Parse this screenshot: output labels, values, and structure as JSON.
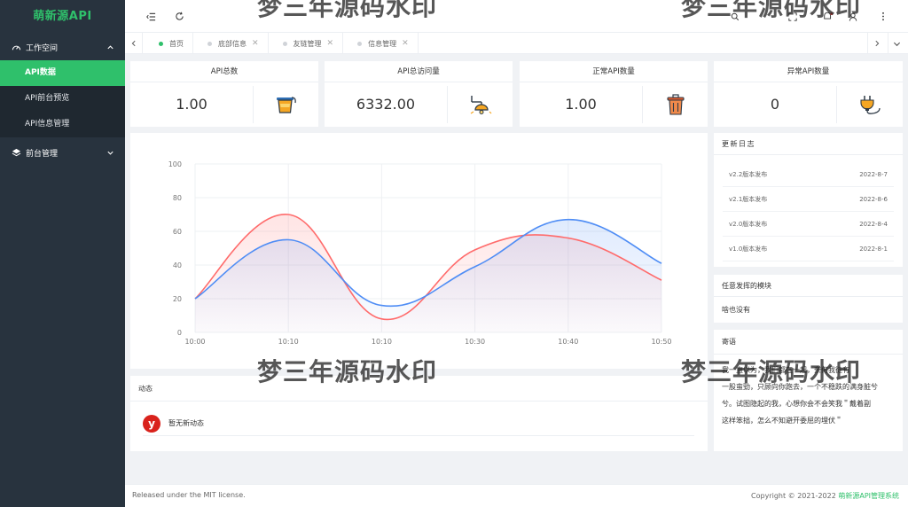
{
  "sidebar": {
    "brand": "萌新源API",
    "groups": [
      {
        "label": "工作空间",
        "items": [
          {
            "label": "API数据"
          },
          {
            "label": "API前台预览"
          },
          {
            "label": "API信息管理"
          }
        ]
      },
      {
        "label": "前台管理"
      }
    ]
  },
  "tabs": [
    {
      "label": "首页"
    },
    {
      "label": "底部信息"
    },
    {
      "label": "友链管理"
    },
    {
      "label": "信息管理"
    }
  ],
  "stats": [
    {
      "title": "API总数",
      "value": "1.00"
    },
    {
      "title": "API总访问量",
      "value": "6332.00"
    },
    {
      "title": "正常API数量",
      "value": "1.00"
    },
    {
      "title": "异常API数量",
      "value": "0"
    }
  ],
  "chart_data": {
    "type": "line",
    "categories": [
      "10:00",
      "10:10",
      "10:10",
      "10:30",
      "10:40",
      "10:50"
    ],
    "ylim": [
      0,
      100
    ],
    "yticks": [
      0,
      20,
      40,
      60,
      80,
      100
    ],
    "grid": true,
    "series": [
      {
        "color": "#ff6b6b",
        "values": [
          20,
          70,
          8,
          49,
          56,
          31
        ]
      },
      {
        "color": "#4f8df5",
        "values": [
          20,
          55,
          16,
          39,
          67,
          41
        ]
      }
    ]
  },
  "dynamic": {
    "title": "动态",
    "logo": "y",
    "message": "暂无新动态"
  },
  "update_log": {
    "title": "更新日志",
    "items": [
      {
        "label": "v2.2版本发布",
        "date": "2022-8-7"
      },
      {
        "label": "v2.1版本发布",
        "date": "2022-8-6"
      },
      {
        "label": "v2.0版本发布",
        "date": "2022-8-4"
      },
      {
        "label": "v1.0版本发布",
        "date": "2022-8-1"
      }
    ]
  },
  "module": {
    "title": "任意发挥的模块",
    "body": "啥也没有"
  },
  "quote": {
    "title": "寄语",
    "lines": [
      "我一直以为，我们都在一起，奈何我徒有",
      "一股蛮勁，只顾向你跑去，一个不稳跌的满身脏兮",
      "兮。试图隐起的我，心想你会不会笑我＂戴着副",
      "这样笨拙，怎么不知避开委屈的埋伏＂"
    ]
  },
  "footer": {
    "left": "Released under the MIT license.",
    "right_prefix": "Copyright © 2021-2022 ",
    "right_brand": "萌新源API管理系统"
  },
  "watermark": "梦三年源码水印",
  "colors": {
    "accent": "#2fc06b",
    "sidebar_bg": "#28333e",
    "sidebar_sub_bg": "#1f2830"
  }
}
